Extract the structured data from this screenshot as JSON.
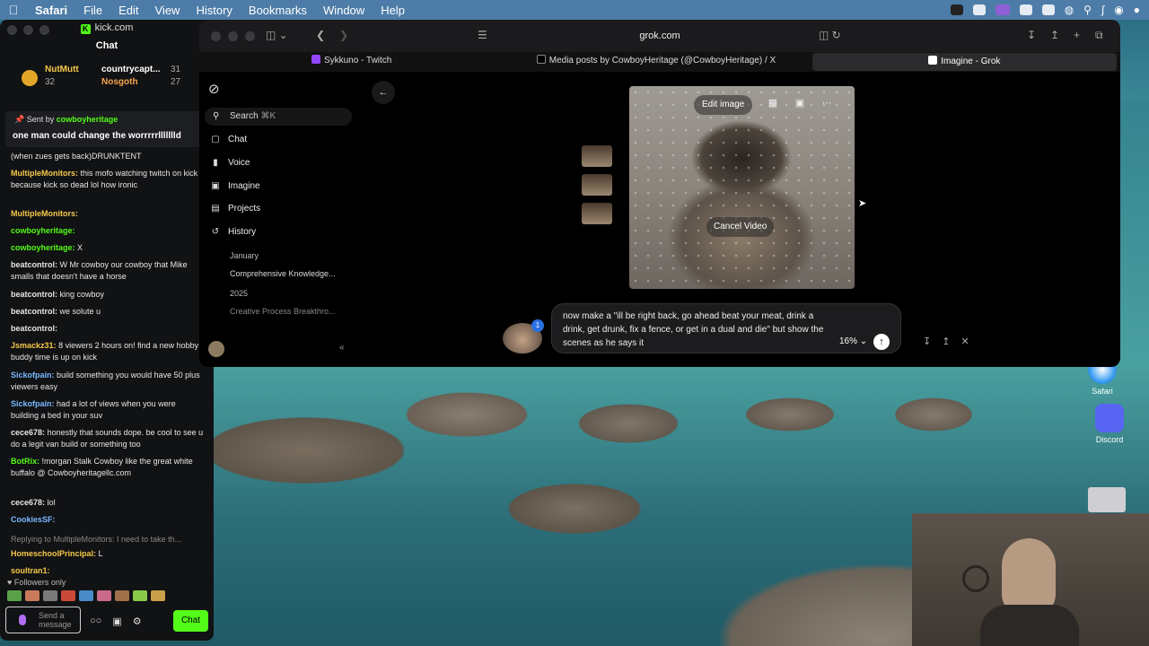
{
  "menubar": {
    "app": "Safari",
    "items": [
      "File",
      "Edit",
      "View",
      "History",
      "Bookmarks",
      "Window",
      "Help"
    ]
  },
  "chat_window": {
    "site": "kick.com",
    "title": "Chat",
    "leaders": [
      {
        "name": "NutMutt",
        "count": "32"
      },
      {
        "name": "countrycapt...",
        "count": "31"
      },
      {
        "name": "Nosgoth",
        "count": "27"
      }
    ],
    "pinned": {
      "prefix": "Sent by",
      "user": "cowboyheritage",
      "message": "one man could change the worrrrrllllllld"
    },
    "messages": [
      {
        "user": "",
        "text": "(when zues gets back)DRUNKTENT",
        "color": "#e6e6e6"
      },
      {
        "user": "MultipleMonitors:",
        "text": "this mofo watching twitch on kick because kick so dead lol how ironic",
        "color": "#f6c84a"
      },
      {
        "user": "MultipleMonitors:",
        "text": "",
        "color": "#f6c84a"
      },
      {
        "user": "cowboyheritage:",
        "text": "",
        "color": "#53fc18"
      },
      {
        "user": "cowboyheritage:",
        "text": "X",
        "color": "#53fc18"
      },
      {
        "user": "beatcontrol:",
        "text": "W Mr cowboy our cowboy that Mike smalls that doesn't have a horse",
        "color": "#e6e6e6"
      },
      {
        "user": "beatcontrol:",
        "text": "king cowboy",
        "color": "#e6e6e6"
      },
      {
        "user": "beatcontrol:",
        "text": "we solute u",
        "color": "#e6e6e6"
      },
      {
        "user": "beatcontrol:",
        "text": "",
        "color": "#e6e6e6"
      },
      {
        "user": "Jsmackz31:",
        "text": "8 viewers 2 hours on! find a new hobby buddy time is up on kick",
        "color": "#f6c84a"
      },
      {
        "user": "Sickofpain:",
        "text": "build something you would have 50 plus viewers easy",
        "color": "#7ab8ff"
      },
      {
        "user": "Sickofpain:",
        "text": "had a lot of views when you were building a bed in your suv",
        "color": "#7ab8ff"
      },
      {
        "user": "cece678:",
        "text": "honestly that sounds dope. be cool to see u do a legit van build or something too",
        "color": "#e6e6e6"
      },
      {
        "user": "BotRix:",
        "text": "!morgan Stalk Cowboy like the great white buffalo @ Cowboyheritagellc.com",
        "color": "#53fc18"
      },
      {
        "user": "cece678:",
        "text": "lol",
        "color": "#e6e6e6"
      },
      {
        "user": "CookiesSF:",
        "text": "",
        "color": "#7ab8ff"
      },
      {
        "user": "",
        "text": "Replying to MultipleMonitors: I need to take th...",
        "color": "#888888"
      },
      {
        "user": "HomeschoolPrincipal:",
        "text": "L",
        "color": "#f6c84a"
      },
      {
        "user": "soultran1:",
        "text": "",
        "color": "#f6c84a"
      }
    ],
    "followers_only": "Followers only",
    "input_placeholder": "Send a message",
    "chat_button": "Chat"
  },
  "safari": {
    "url": "grok.com",
    "tabs": [
      {
        "label": "Sykkuno - Twitch",
        "color": "#9146ff",
        "active": false
      },
      {
        "label": "Media posts by CowboyHeritage (@CowboyHeritage) / X",
        "color": "#000000",
        "active": false
      },
      {
        "label": "Imagine - Grok",
        "color": "#ffffff",
        "active": true
      }
    ]
  },
  "grok": {
    "search": "Search",
    "search_shortcut": "⌘K",
    "nav": [
      "Chat",
      "Voice",
      "Imagine",
      "Projects",
      "History"
    ],
    "history": [
      {
        "label": "January",
        "dim": false
      },
      {
        "label": "Comprehensive Knowledge...",
        "dim": false
      },
      {
        "label": "2025",
        "dim": false
      },
      {
        "label": "Creative Process Breakthro...",
        "dim": true
      }
    ],
    "edit_image": "Edit image",
    "cancel_video": "Cancel Video",
    "prompt_text": "now make a \"ill be right back, go ahead beat your meat, drink a drink, get drunk, fix a fence, or get in a dual and die\" but show the scenes as he says it",
    "progress": "16%",
    "notification_count": "1"
  },
  "desktop": {
    "safari_label": "Safari",
    "discord_label": "Discord"
  }
}
